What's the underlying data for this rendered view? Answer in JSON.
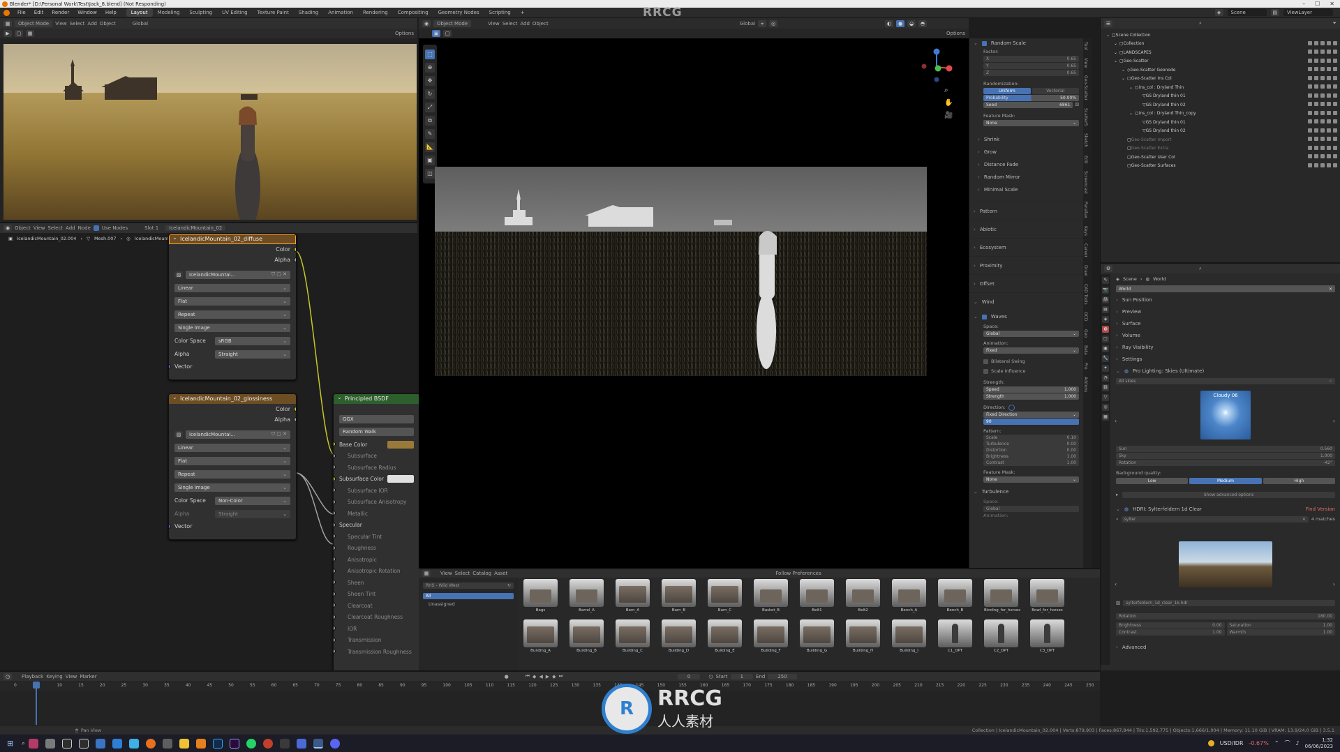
{
  "titlebar": {
    "title": "Blender* [D:\\Personal Work\\Test\\Jack_8.blend] (Not Responding)"
  },
  "menubar": {
    "items": [
      "File",
      "Edit",
      "Render",
      "Window",
      "Help"
    ],
    "workspaces": [
      "Layout",
      "Modeling",
      "Sculpting",
      "UV Editing",
      "Texture Paint",
      "Shading",
      "Animation",
      "Rendering",
      "Compositing",
      "Geometry Nodes",
      "Scripting"
    ],
    "active_workspace": "Layout",
    "plus": "+",
    "scene": "Scene",
    "viewlayer": "ViewLayer"
  },
  "watermarks": [
    "RRCG",
    "人人素材"
  ],
  "image_editor": {
    "mode": "Object Mode",
    "menus": [
      "View",
      "Select",
      "Add",
      "Object"
    ],
    "transform": "Global",
    "options": "Options"
  },
  "node_editor": {
    "header": {
      "object": "Object",
      "menus": [
        "View",
        "Select",
        "Add",
        "Node"
      ],
      "use_nodes": "Use Nodes",
      "slot": "Slot 1",
      "material": "IcelandicMountain_02"
    },
    "breadcrumb": [
      "IcelandicMountain_02.004",
      "Mesh.007",
      "IcelandicMountain_02"
    ],
    "diffuse": {
      "title": "IcelandicMountain_02_diffuse",
      "out_color": "Color",
      "out_alpha": "Alpha",
      "image": "IcelandicMountai...",
      "interp": "Linear",
      "proj": "Flat",
      "ext": "Repeat",
      "source": "Single Image",
      "cs_label": "Color Space",
      "cs_value": "sRGB",
      "alpha_label": "Alpha",
      "alpha_value": "Straight",
      "vector": "Vector"
    },
    "gloss": {
      "title": "IcelandicMountain_02_glossiness",
      "out_color": "Color",
      "out_alpha": "Alpha",
      "image": "IcelandicMountai...",
      "interp": "Linear",
      "proj": "Flat",
      "ext": "Repeat",
      "source": "Single Image",
      "cs_label": "Color Space",
      "cs_value": "Non-Color",
      "alpha_label": "Alpha",
      "alpha_value": "Straight",
      "vector": "Vector"
    },
    "bsdf": {
      "title": "Principled BSDF",
      "dist": "GGX",
      "sss": "Random Walk",
      "inputs": [
        "Base Color",
        "Subsurface",
        "Subsurface Radius",
        "Subsurface Color",
        "Subsurface IOR",
        "Subsurface Anisotropy",
        "Metallic",
        "Specular",
        "Specular Tint",
        "Roughness",
        "Anisotropic",
        "Anisotropic Rotation",
        "Sheen",
        "Sheen Tint",
        "Clearcoat",
        "Clearcoat Roughness",
        "IOR",
        "Transmission",
        "Transmission Roughness"
      ]
    }
  },
  "viewport": {
    "mode": "Object Mode",
    "menus": [
      "View",
      "Select",
      "Add",
      "Object"
    ],
    "transform": "Global",
    "options": "Options"
  },
  "geo_panel": {
    "section": "Random Scale",
    "factor": "Factor:",
    "x": "X",
    "y": "Y",
    "z": "Z",
    "x_val": "0.65",
    "y_val": "0.65",
    "z_val": "0.65",
    "randomization": "Randomization:",
    "uniform": "Uniform",
    "vectorial": "Vectorial",
    "probability": "Probability",
    "probability_val": "50.00%",
    "seed": "Seed",
    "seed_val": "6861",
    "feature_mask": "Feature Mask:",
    "none": "None",
    "subsections": [
      "Shrink",
      "Grow",
      "Distance Fade",
      "Random Mirror",
      "Minimal Scale"
    ],
    "sections": [
      "Pattern",
      "Abiotic",
      "Ecosystem",
      "Proximity",
      "Offset",
      "Wind"
    ],
    "waves": "Waves",
    "space": "Space:",
    "space_val": "Global",
    "animation": "Animation:",
    "animation_val": "Fixed",
    "bilateral": "Bilateral Swing",
    "scale_influence": "Scale Influence",
    "strength": "Strength:",
    "speed": "Speed",
    "speed_val": "1.000",
    "strength_lbl": "Strength",
    "strength_val": "1.000",
    "direction": "Direction:",
    "direction_val": "Fixed Direction",
    "direction_num": "90",
    "pattern": "Pattern:",
    "pattern_rows": [
      [
        "Scale",
        "0.10"
      ],
      [
        "Turbulence",
        "0.00"
      ],
      [
        "Distortion",
        "0.00"
      ],
      [
        "Brightness",
        "1.00"
      ],
      [
        "Contrast",
        "1.00"
      ]
    ],
    "feature_mask2": "Feature Mask:",
    "none2": "None",
    "turbulence": "Turbulence",
    "space2": "Space:",
    "space2_val": "Global",
    "animation2": "Animation:"
  },
  "side_tabs": [
    "Tool",
    "View",
    "Geo-Scatter",
    "Scatter5",
    "Sketch",
    "Edit",
    "Screencast",
    "Parallax",
    "Keys",
    "Carver",
    "Draw",
    "CAD Tools",
    "OCD",
    "Geo",
    "Beta",
    "Pro",
    "Addons"
  ],
  "outliner": {
    "items": [
      "Scene Collection",
      "Collection",
      "LANDSCAPES",
      "Geo-Scatter",
      "Geo-Scatter Geonode",
      "Geo-Scatter Ins Col",
      "ins_col : Dryland Thin",
      "GS Dryland thin 01",
      "GS Dryland thin 02",
      "ins_col : Dryland Thin_copy",
      "GS Dryland thin 01",
      "GS Dryland thin 02",
      "Geo-Scatter Import",
      "Geo-Scatter Extra",
      "Geo-Scatter User Col",
      "Geo-Scatter Surfaces"
    ]
  },
  "world_panel": {
    "scene": "Scene",
    "world": "World",
    "world_field": "World",
    "sections": [
      "Sun Position",
      "Preview",
      "Surface",
      "Volume",
      "Ray Visibility",
      "Settings"
    ],
    "pro_lighting": "Pro Lighting: Skies (Ultimate)",
    "all_skies": "All skies",
    "sky_name": "Cloudy 06",
    "sun": "Sun",
    "sun_val": "0.560",
    "sky": "Sky",
    "sky_val": "1.000",
    "rotation": "Rotation",
    "rotation_val": "-42°",
    "bg_quality": "Background quality:",
    "q_low": "Low",
    "q_medium": "Medium",
    "q_high": "High",
    "show_adv": "Show advanced options",
    "hdri": "HDRI: Sylterfeldern 1d Clear",
    "find": "Find Version",
    "search": "sylter",
    "matches": "4 matches",
    "hdr_file": "sylterfeldern_1d_clear_1k.hdr",
    "rot2": "Rotation",
    "rot2_val": "180.00",
    "brightness": "Brightness",
    "brightness_val": "0.00",
    "saturation": "Saturation",
    "saturation_val": "1.00",
    "contrast": "Contrast",
    "contrast_val": "1.00",
    "warmth": "Warmth",
    "warmth_val": "1.00",
    "advanced": "Advanced"
  },
  "asset_browser": {
    "menus": [
      "View",
      "Select",
      "Catalog",
      "Asset"
    ],
    "follow": "Follow Preferences",
    "library": "RHS - Wild West",
    "all": "All",
    "unassigned": "Unassigned",
    "row1": [
      "Bags",
      "Barrel_A",
      "Barn_A",
      "Barn_B",
      "Barn_C",
      "Basket_B",
      "Belt1",
      "Belt2",
      "Bench_A",
      "Bench_B",
      "Binding_for_horses",
      "Bowl_for_horses"
    ],
    "row2": [
      "Building_A",
      "Building_B",
      "Building_C",
      "Building_D",
      "Building_E",
      "Building_F",
      "Building_G",
      "Building_H",
      "Building_I",
      "C1_OPT",
      "C2_OPT",
      "C3_OPT"
    ]
  },
  "timeline": {
    "menus": [
      "Playback",
      "Keying",
      "View",
      "Marker"
    ],
    "current": "0",
    "start_lbl": "Start",
    "start": "1",
    "end_lbl": "End",
    "end": "250",
    "ticks": [
      "0",
      "5",
      "10",
      "15",
      "20",
      "25",
      "30",
      "35",
      "40",
      "45",
      "50",
      "55",
      "60",
      "65",
      "70",
      "75",
      "80",
      "85",
      "90",
      "95",
      "100",
      "105",
      "110",
      "115",
      "120",
      "125",
      "130",
      "135",
      "140",
      "145",
      "150",
      "155",
      "160",
      "165",
      "170",
      "175",
      "180",
      "185",
      "190",
      "195",
      "200",
      "205",
      "210",
      "215",
      "220",
      "225",
      "230",
      "235",
      "240",
      "245",
      "250"
    ]
  },
  "statusbar": {
    "pan": "Pan View",
    "stats": "Collection | IcelandicMountain_02.004 | Verts:879,903 | Faces:867,844 | Tris:1,592,775 | Objects:1,666/1,004 | Memory: 11.10 GiB | VRAM: 13.9/24.0 GiB | 3.5.1"
  },
  "taskbar": {
    "currency": "USD/IDR",
    "change": "-0.67%",
    "time": "1:32",
    "date": "06/06/2023"
  }
}
